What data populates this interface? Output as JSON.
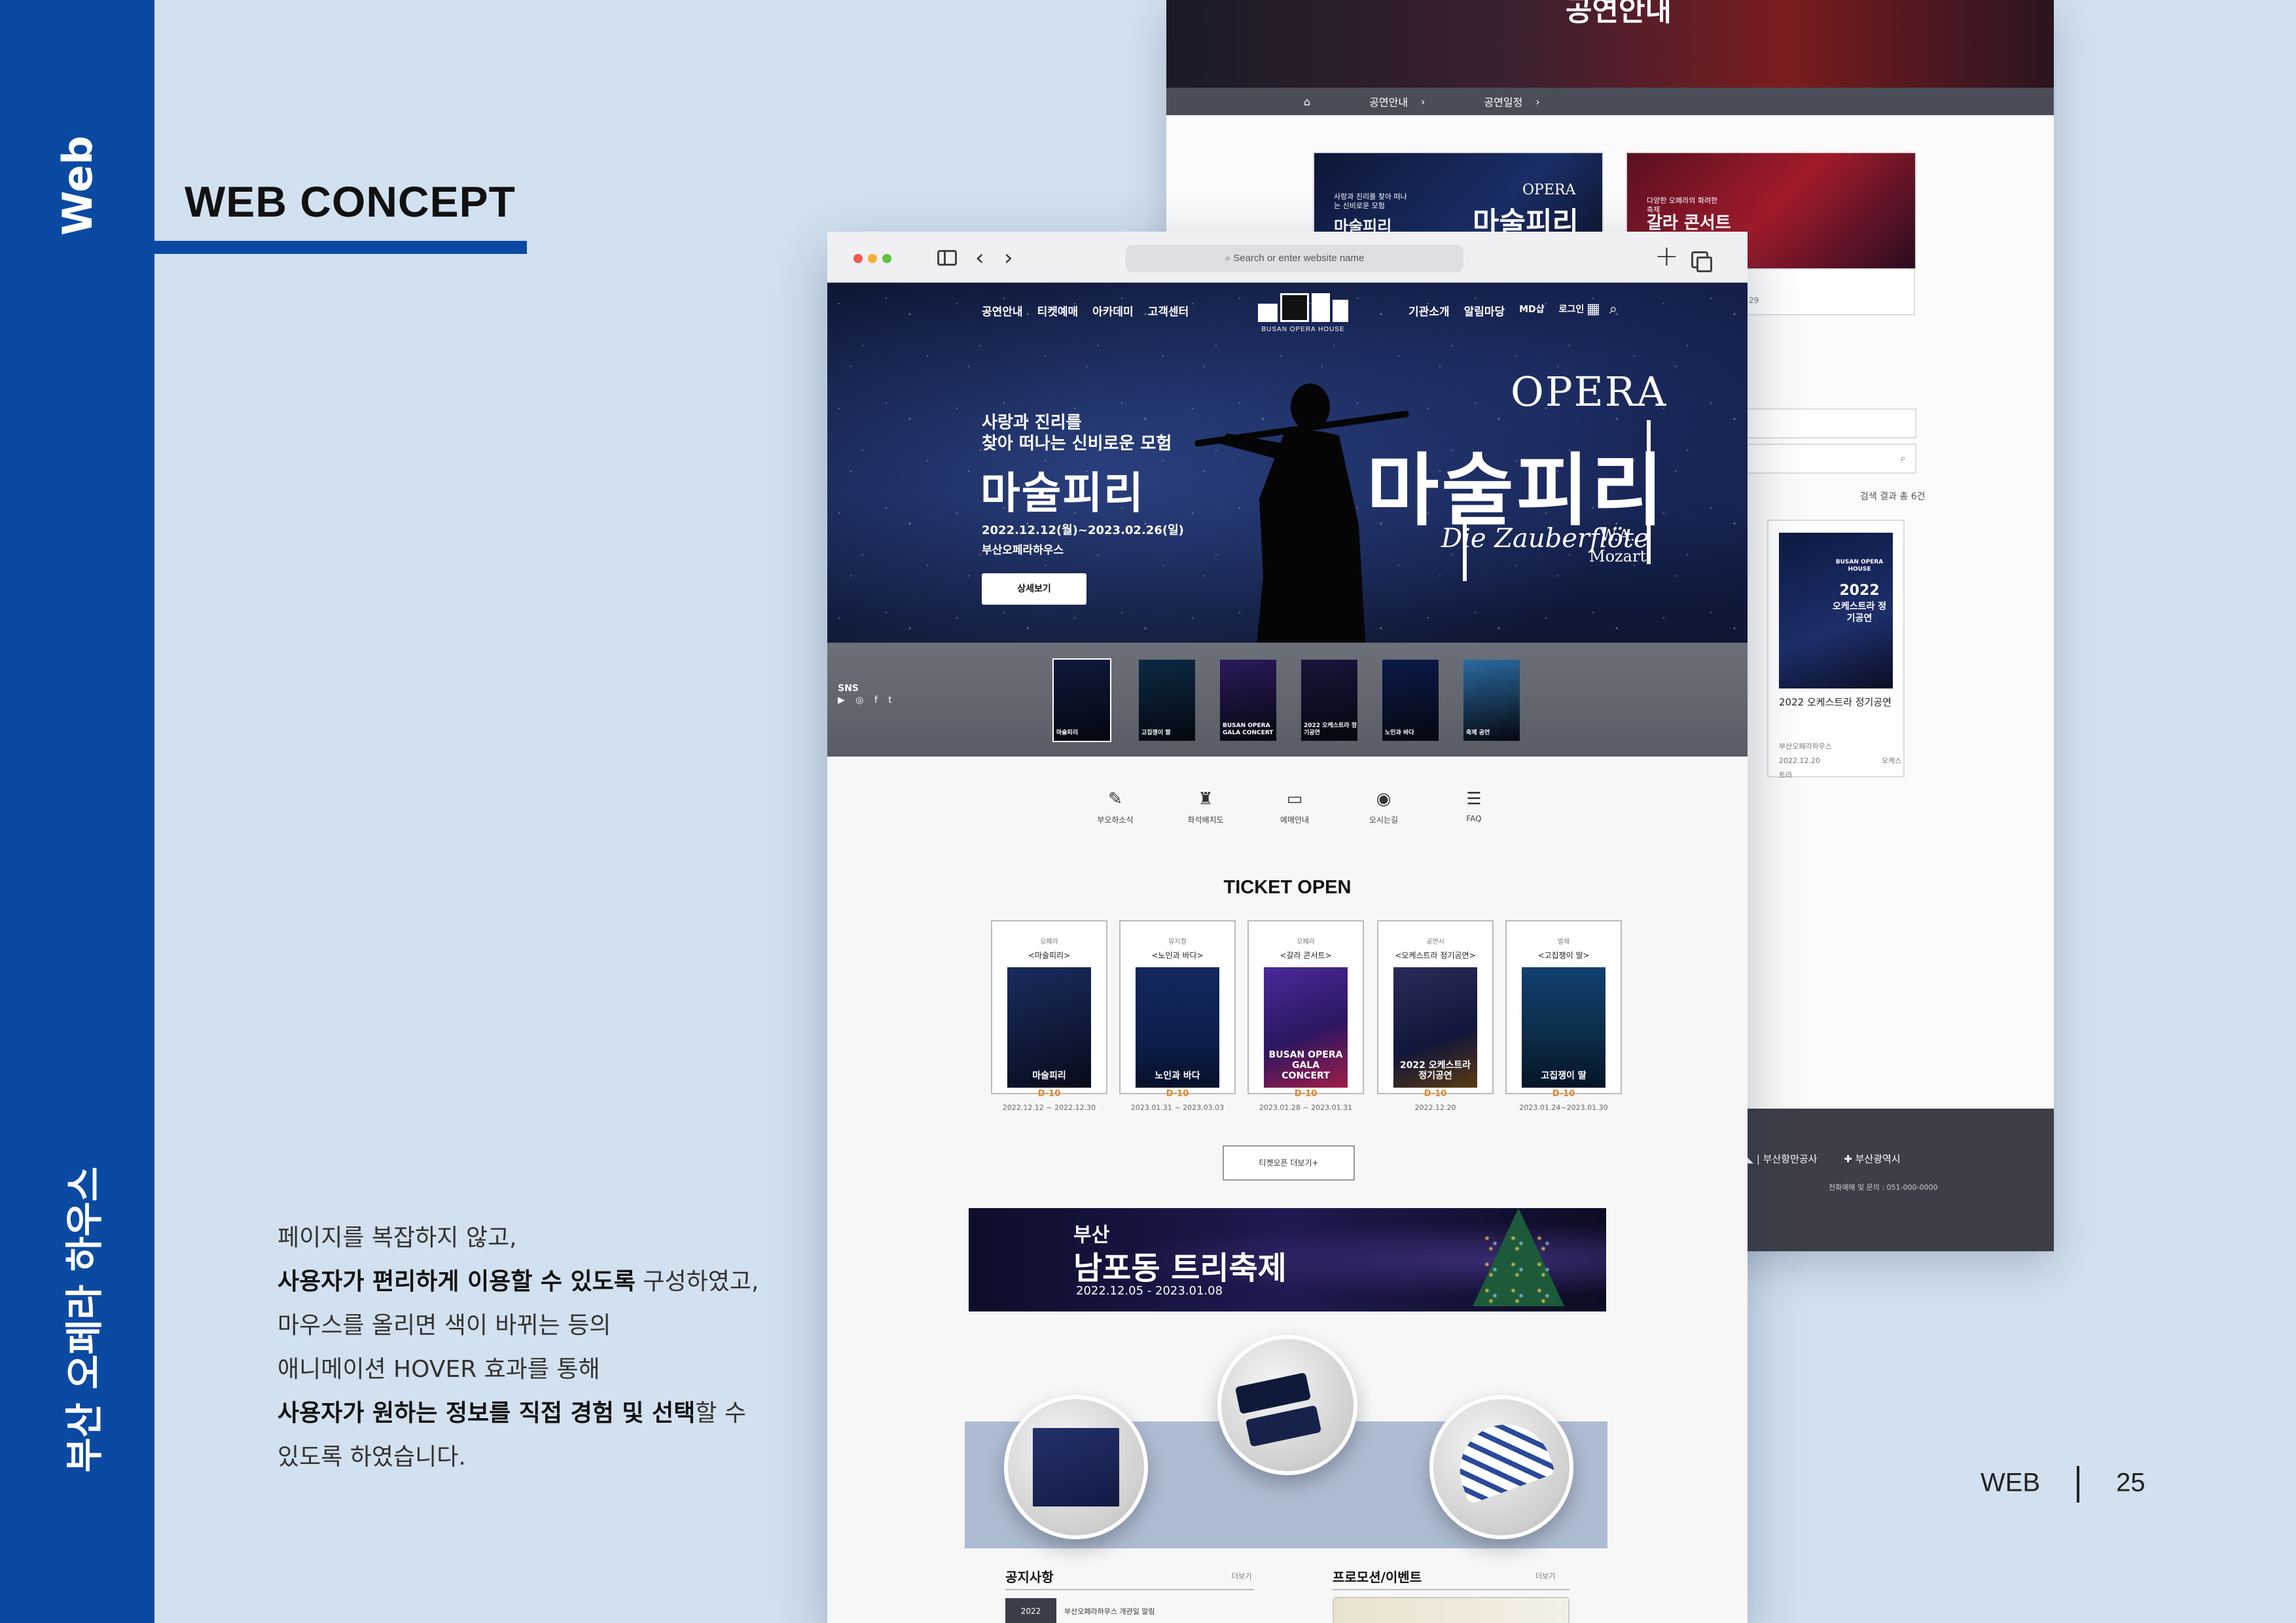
{
  "side": {
    "web_label": "Web",
    "project_label": "부산 오페라 하우스"
  },
  "concept_title": "WEB CONCEPT",
  "description": {
    "line1": "페이지를 복잡하지 않고,",
    "line2_bold": "사용자가 편리하게 이용할 수 있도록",
    "line2_rest": " 구성하였고,",
    "line3": "마우스를 올리면 색이 바뀌는 등의",
    "line4": "애니메이션 HOVER 효과를 통해",
    "line5_bold": "사용자가 원하는 정보를 직접 경험 및 선택",
    "line5_rest": "할 수",
    "line6": "있도록 하였습니다."
  },
  "pager": {
    "section": "WEB",
    "page": "25"
  },
  "back_page": {
    "hero_title": "공연안내",
    "breadcrumb": [
      "공연안내",
      "공연일정"
    ],
    "card1": {
      "small": "사랑과 진리를 찾아 떠나는 신비로운 모험",
      "opera": "OPERA",
      "title": "마술피리",
      "title2": "마술피리"
    },
    "card2": {
      "small": "다양한 오페라의 화려한 축제",
      "title": "갈라 콘서트"
    },
    "card_date": "29",
    "result_count": "검색 결과 총 6건",
    "product": {
      "poster_brand": "BUSAN OPERA HOUSE",
      "poster_year": "2022",
      "poster_title": "오케스트라 정기공연",
      "title": "2022 오케스트라 정기공연",
      "venue": "부산오페라하우스",
      "date": "2022.12.20",
      "category": "오케스트라"
    },
    "footer": {
      "org1": "부산항만공사",
      "org2": "부산광역시",
      "tel": "전화예매 및 문의 : 051-000-0000"
    }
  },
  "browser": {
    "address_placeholder": "Search or enter website name",
    "back_arrow": "‹",
    "forward_arrow": "›",
    "new_tab": "+"
  },
  "site": {
    "nav_left": [
      "공연안내",
      "티켓예매",
      "아카데미",
      "고객센터"
    ],
    "nav_right": [
      "기관소개",
      "알림마당",
      "MD샵",
      "로그인"
    ],
    "logo_text": "BUSAN OPERA HOUSE",
    "hero": {
      "sub1": "사랑과 진리를",
      "sub2": "찾아 떠나는 신비로운 모험",
      "title": "마술피리",
      "date": "2022.12.12(월)~2023.02.26(일)",
      "venue": "부산오페라하우스",
      "button": "상세보기",
      "opera_word": "OPERA",
      "opera_big": "마술피리",
      "zauber": "Die Zauberflöte",
      "mozart1": "W.A.",
      "mozart2": "Mozart"
    },
    "sns": {
      "label": "SNS",
      "icons": "▶ ◎ f t"
    },
    "thumbs": [
      {
        "label": "마술피리",
        "color": "#0e1a3c"
      },
      {
        "label": "고집쟁이 딸",
        "color": "#0c2a44"
      },
      {
        "label": "BUSAN OPERA GALA CONCERT",
        "color": "#2a1a5a"
      },
      {
        "label": "2022 오케스트라 정기공연",
        "color": "#15163a"
      },
      {
        "label": "노인과 바다",
        "color": "#0b1a4a"
      },
      {
        "label": "축제 공연",
        "color": "#2a6aa0"
      }
    ],
    "quick_menu": [
      {
        "icon": "✎",
        "label": "부오하소식"
      },
      {
        "icon": "♜",
        "label": "좌석배치도"
      },
      {
        "icon": "▭",
        "label": "예매안내"
      },
      {
        "icon": "◉",
        "label": "오시는길"
      },
      {
        "icon": "☰",
        "label": "FAQ"
      }
    ],
    "ticket_open_title": "TICKET OPEN",
    "tickets": [
      {
        "category": "오페라",
        "name": "<마술피리>",
        "poster": "마술피리",
        "dday": "D-10",
        "date": "2022.12.12 ~ 2022.12.30",
        "color": "#0f1838"
      },
      {
        "category": "뮤지컬",
        "name": "<노인과 바다>",
        "poster": "노인과 바다",
        "dday": "D-10",
        "date": "2023.01.31 ~ 2023.03.03",
        "color": "#0c1f4c"
      },
      {
        "category": "오페라",
        "name": "<갈라 콘서트>",
        "poster": "BUSAN OPERA GALA CONCERT",
        "dday": "D-10",
        "date": "2023.01.28 ~ 2023.01.31",
        "color": "#2c1660"
      },
      {
        "category": "공연시",
        "name": "<오케스트라 정기공연>",
        "poster": "2022 오케스트라 정기공연",
        "dday": "D-10",
        "date": "2022.12.20",
        "color": "#12163a"
      },
      {
        "category": "발레",
        "name": "<고집쟁이 딸>",
        "poster": "고집쟁이 딸",
        "dday": "D-10",
        "date": "2023.01.24~2023.01.30",
        "color": "#0b2b46"
      }
    ],
    "more_button": "티켓오픈 더보기+",
    "banner": {
      "line1": "부산",
      "line2": "남포동 트리축제",
      "date": "2022.12.05 - 2023.01.08"
    },
    "notice": {
      "title": "공지사항",
      "more": "더보기",
      "tag": "2022",
      "item": "부산오페라하우스 개관일 알림"
    },
    "promo": {
      "title": "프로모션/이벤트",
      "more": "더보기"
    }
  }
}
